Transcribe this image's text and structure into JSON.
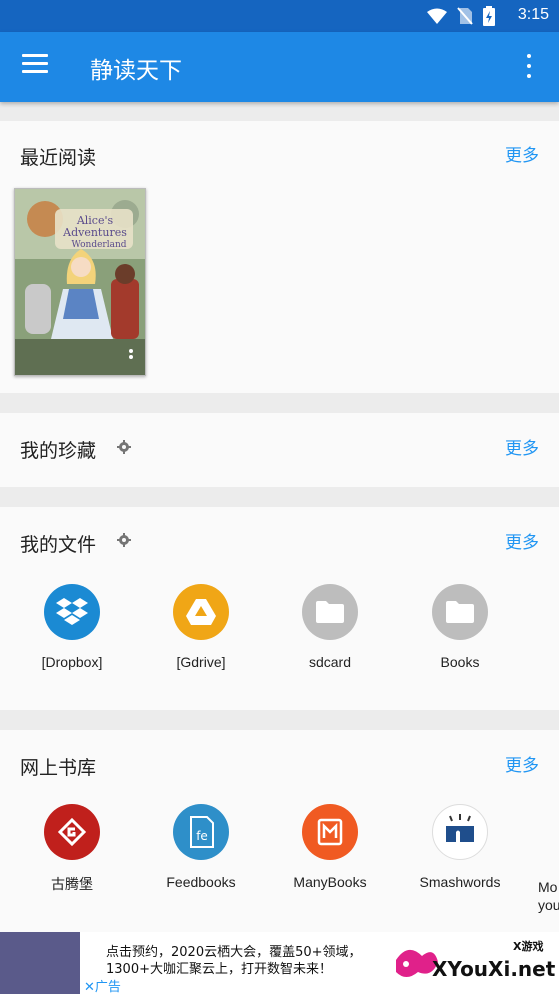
{
  "status": {
    "time": "3:15"
  },
  "appbar": {
    "title": "静读天下"
  },
  "recent": {
    "title": "最近阅读",
    "more": "更多",
    "book_title_line1": "Alice's",
    "book_title_line2": "Adventures",
    "book_title_line3": "Wonderland"
  },
  "favorites": {
    "title": "我的珍藏",
    "more": "更多"
  },
  "files": {
    "title": "我的文件",
    "more": "更多",
    "items": [
      {
        "label": "[Dropbox]",
        "icon": "dropbox-icon"
      },
      {
        "label": "[Gdrive]",
        "icon": "google-drive-icon"
      },
      {
        "label": "sdcard",
        "icon": "folder-icon"
      },
      {
        "label": "Books",
        "icon": "folder-icon"
      }
    ]
  },
  "online": {
    "title": "网上书库",
    "more": "更多",
    "items": [
      {
        "label": "古腾堡",
        "icon": "gutenberg-icon"
      },
      {
        "label": "Feedbooks",
        "icon": "feedbooks-icon"
      },
      {
        "label": "ManyBooks",
        "icon": "manybooks-icon"
      },
      {
        "label": "Smashwords",
        "icon": "smashwords-icon"
      },
      {
        "label": "Mo",
        "label2": "you",
        "icon": "more-library-icon"
      }
    ]
  },
  "ad": {
    "line1": "点击预约，2020云栖大会，覆盖50+领域，",
    "line2": "1300+大咖汇聚云上，打开数智未来！",
    "label": "广告",
    "brand": "XYouXi.net",
    "brand_small": "X游戏"
  },
  "colors": {
    "appbar": "#1e88e5",
    "statusbar": "#1565c0",
    "accent": "#2196f3"
  }
}
